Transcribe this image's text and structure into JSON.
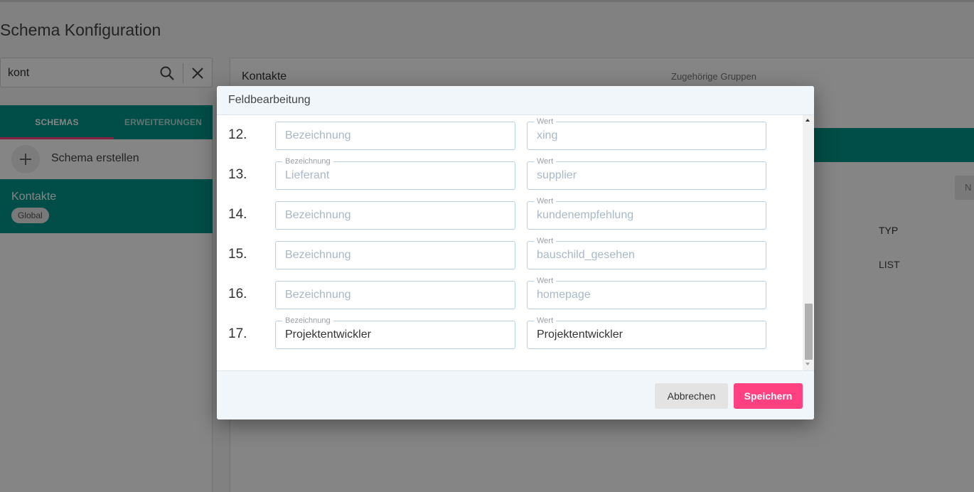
{
  "page": {
    "title": "Schema Konfiguration"
  },
  "search": {
    "value": "kont"
  },
  "tabs": [
    {
      "label": "SCHEMAS",
      "active": true
    },
    {
      "label": "ERWEITERUNGEN",
      "active": false
    }
  ],
  "sidebar": {
    "create_label": "Schema erstellen",
    "items": [
      {
        "name": "Kontakte",
        "badge": "Global"
      }
    ]
  },
  "detail": {
    "title": "Kontakte",
    "groups_label": "Zugehörige Gruppen",
    "button_partial": "N",
    "column_header": "TYP",
    "column_value": "LIST"
  },
  "dialog": {
    "title": "Feldbearbeitung",
    "label_bezeichnung": "Bezeichnung",
    "label_wert": "Wert",
    "rows": [
      {
        "num": "12.",
        "bezeichnung": "",
        "wert": "xing"
      },
      {
        "num": "13.",
        "bezeichnung": "Lieferant",
        "wert": "supplier"
      },
      {
        "num": "14.",
        "bezeichnung": "",
        "wert": "kundenempfehlung"
      },
      {
        "num": "15.",
        "bezeichnung": "",
        "wert": "bauschild_gesehen"
      },
      {
        "num": "16.",
        "bezeichnung": "",
        "wert": "homepage"
      },
      {
        "num": "17.",
        "bezeichnung": "Projektentwickler",
        "wert": "Projektentwickler",
        "dark": true
      }
    ],
    "cancel_label": "Abbrechen",
    "save_label": "Speichern"
  },
  "colors": {
    "teal": "#009688",
    "accent": "#ff4081"
  },
  "icons": [
    "search-icon",
    "close-icon",
    "plus-icon"
  ]
}
